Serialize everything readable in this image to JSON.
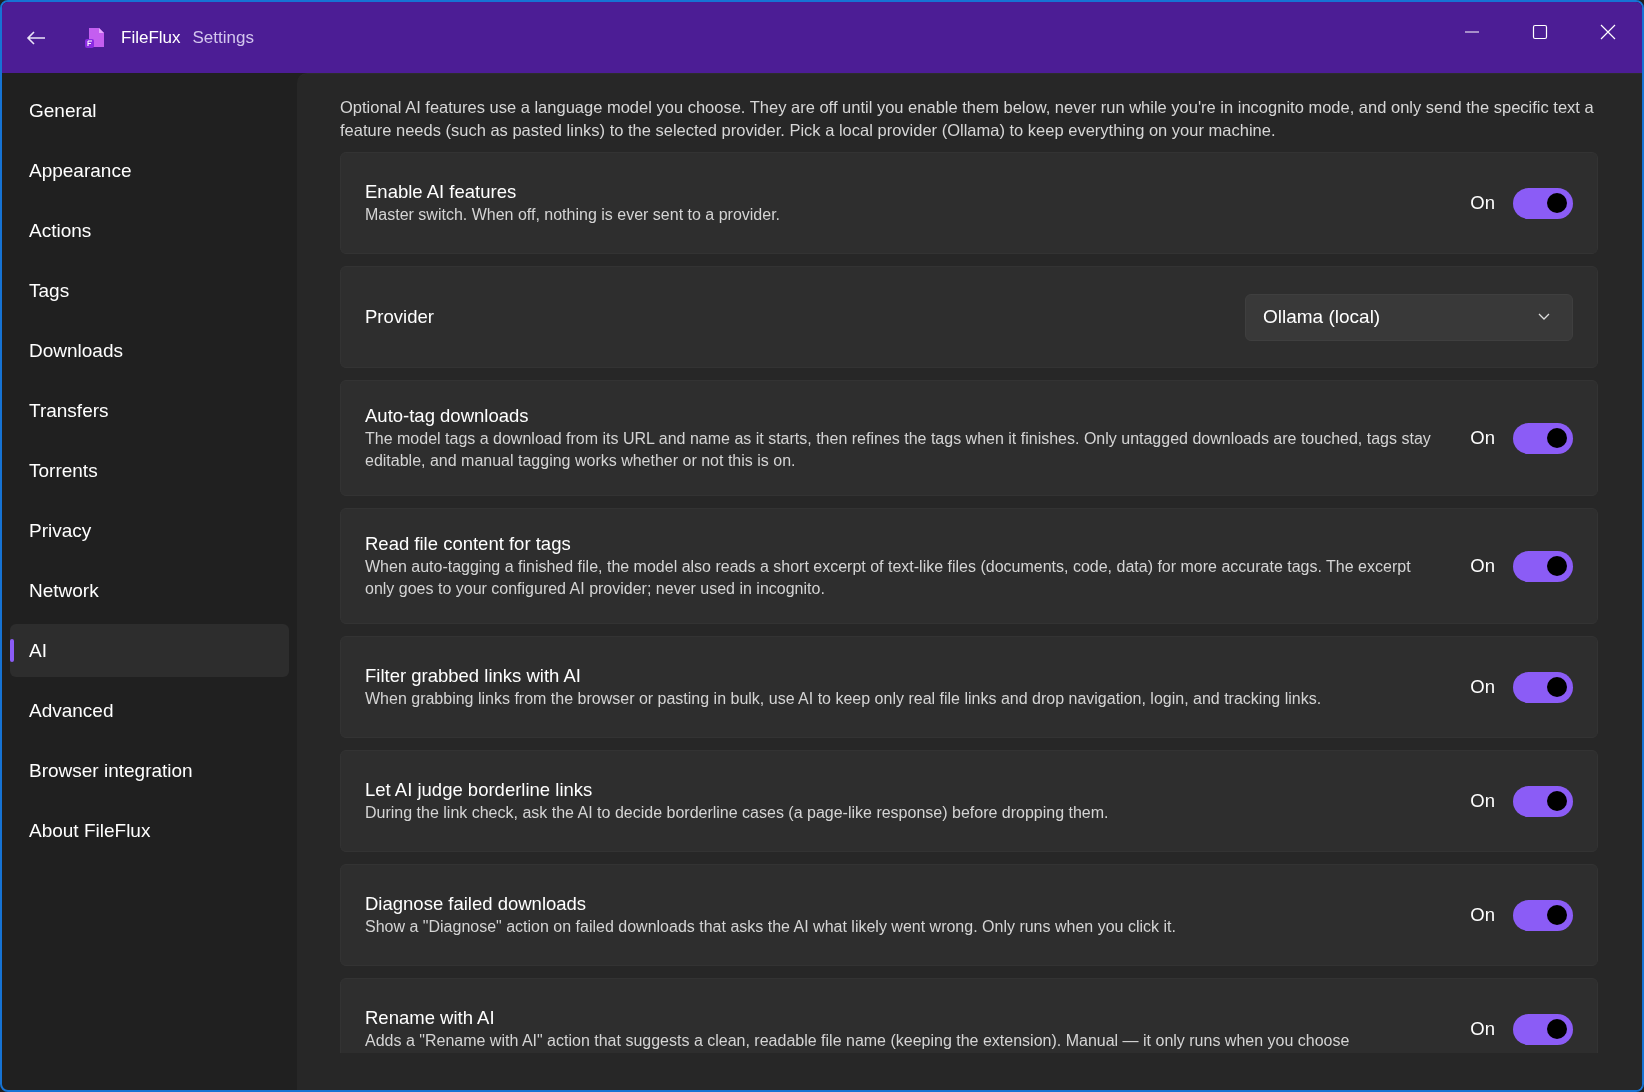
{
  "window": {
    "app_name": "FileFlux",
    "title": "Settings"
  },
  "sidebar": {
    "items": [
      {
        "label": "General",
        "selected": false
      },
      {
        "label": "Appearance",
        "selected": false
      },
      {
        "label": "Actions",
        "selected": false
      },
      {
        "label": "Tags",
        "selected": false
      },
      {
        "label": "Downloads",
        "selected": false
      },
      {
        "label": "Transfers",
        "selected": false
      },
      {
        "label": "Torrents",
        "selected": false
      },
      {
        "label": "Privacy",
        "selected": false
      },
      {
        "label": "Network",
        "selected": false
      },
      {
        "label": "AI",
        "selected": true
      },
      {
        "label": "Advanced",
        "selected": false
      },
      {
        "label": "Browser integration",
        "selected": false
      },
      {
        "label": "About FileFlux",
        "selected": false
      }
    ]
  },
  "intro": "Optional AI features use a language model you choose. They are off until you enable them below, never run while you're in incognito mode, and only send the specific text a feature needs (such as pasted links) to the selected provider. Pick a local provider (Ollama) to keep everything on your machine.",
  "settings": [
    {
      "kind": "toggle",
      "title": "Enable AI features",
      "description": "Master switch. When off, nothing is ever sent to a provider.",
      "state_label": "On",
      "on": true
    },
    {
      "kind": "select",
      "title": "Provider",
      "value": "Ollama (local)"
    },
    {
      "kind": "toggle",
      "title": "Auto-tag downloads",
      "description": "The model tags a download from its URL and name as it starts, then refines the tags when it finishes. Only untagged downloads are touched, tags stay editable, and manual tagging works whether or not this is on.",
      "state_label": "On",
      "on": true
    },
    {
      "kind": "toggle",
      "title": "Read file content for tags",
      "description": "When auto-tagging a finished file, the model also reads a short excerpt of text-like files (documents, code, data) for more accurate tags. The excerpt only goes to your configured AI provider; never used in incognito.",
      "state_label": "On",
      "on": true
    },
    {
      "kind": "toggle",
      "title": "Filter grabbed links with AI",
      "description": "When grabbing links from the browser or pasting in bulk, use AI to keep only real file links and drop navigation, login, and tracking links.",
      "state_label": "On",
      "on": true
    },
    {
      "kind": "toggle",
      "title": "Let AI judge borderline links",
      "description": "During the link check, ask the AI to decide borderline cases (a page-like response) before dropping them.",
      "state_label": "On",
      "on": true
    },
    {
      "kind": "toggle",
      "title": "Diagnose failed downloads",
      "description": "Show a \"Diagnose\" action on failed downloads that asks the AI what likely went wrong. Only runs when you click it.",
      "state_label": "On",
      "on": true
    },
    {
      "kind": "toggle",
      "title": "Rename with AI",
      "description": "Adds a \"Rename with AI\" action that suggests a clean, readable file name (keeping the extension). Manual — it only runs when you choose",
      "state_label": "On",
      "on": true
    }
  ]
}
